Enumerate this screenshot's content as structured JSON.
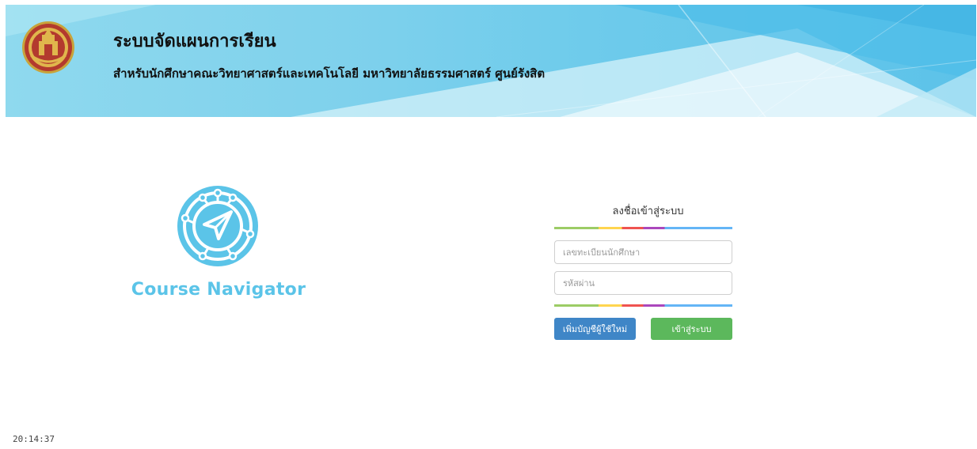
{
  "header": {
    "title": "ระบบจัดแผนการเรียน",
    "subtitle": "สำหรับนักศึกษาคณะวิทยาศาสตร์และเทคโนโลยี มหาวิทยาลัยธรรมศาสตร์ ศูนย์รังสิต",
    "seal_icon": "university-seal-icon",
    "seal_text": "THAMMASAT UNIVERSITY",
    "background_color": "#7fd1ec"
  },
  "logo": {
    "text": "Course Navigator",
    "icon": "compass-navigator-icon",
    "color": "#5bc4e8"
  },
  "login": {
    "title": "ลงชื่อเข้าสู่ระบบ",
    "student_id_placeholder": "เลขทะเบียนนักศึกษา",
    "student_id_value": "",
    "password_placeholder": "รหัสผ่าน",
    "password_value": "",
    "register_label": "เพิ่มบัญชีผู้ใช้ใหม่",
    "login_label": "เข้าสู่ระบบ",
    "register_color": "#3f86c7",
    "login_color": "#5cb85c"
  },
  "footer": {
    "clock": "20:14:37"
  }
}
